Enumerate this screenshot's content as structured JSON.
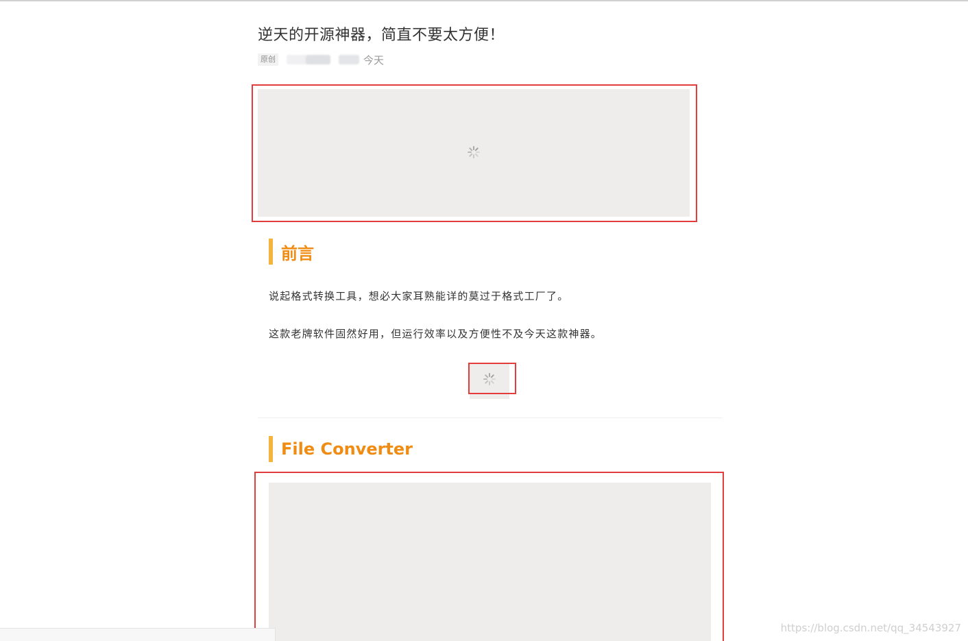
{
  "article": {
    "title": "逆天的开源神器，简直不要太方便！",
    "badge": "原创",
    "date": "今天"
  },
  "sections": [
    {
      "heading": "前言",
      "paragraphs": [
        "说起格式转换工具，想必大家耳熟能详的莫过于格式工厂了。",
        "这款老牌软件固然好用，但运行效率以及方便性不及今天这款神器。"
      ]
    },
    {
      "heading": "File Converter"
    }
  ],
  "watermark": "https://blog.csdn.net/qq_34543927",
  "colors": {
    "heading": "#f08c13",
    "heading_bar": "#f5b43d",
    "annotation": "#e33c3c",
    "placeholder": "#eeedeb"
  },
  "icons": {
    "loading": "loading-spinner-icon"
  }
}
